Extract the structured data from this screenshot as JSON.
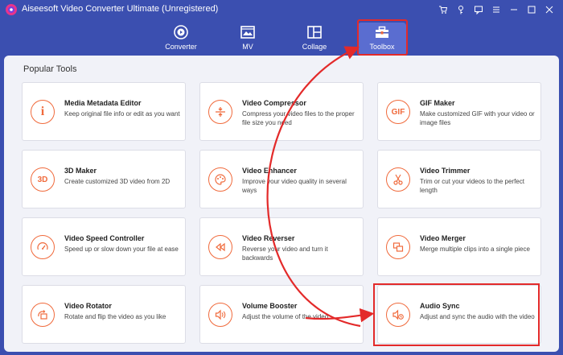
{
  "window": {
    "title": "Aiseesoft Video Converter Ultimate (Unregistered)"
  },
  "nav": {
    "tabs": [
      {
        "label": "Converter",
        "icon": "converter-icon"
      },
      {
        "label": "MV",
        "icon": "mv-icon"
      },
      {
        "label": "Collage",
        "icon": "collage-icon"
      },
      {
        "label": "Toolbox",
        "icon": "toolbox-icon",
        "active": true
      }
    ]
  },
  "section": {
    "title": "Popular Tools"
  },
  "tools": [
    {
      "name": "Media Metadata Editor",
      "desc": "Keep original file info or edit as you want",
      "icon": "info-icon",
      "glyph": "i"
    },
    {
      "name": "Video Compressor",
      "desc": "Compress your video files to the proper file size you need",
      "icon": "compress-icon"
    },
    {
      "name": "GIF Maker",
      "desc": "Make customized GIF with your video or image files",
      "icon": "gif-icon",
      "glyph": "GIF"
    },
    {
      "name": "3D Maker",
      "desc": "Create customized 3D video from 2D",
      "icon": "3d-icon",
      "glyph": "3D"
    },
    {
      "name": "Video Enhancer",
      "desc": "Improve your video quality in several ways",
      "icon": "palette-icon"
    },
    {
      "name": "Video Trimmer",
      "desc": "Trim or cut your videos to the perfect length",
      "icon": "scissors-icon"
    },
    {
      "name": "Video Speed Controller",
      "desc": "Speed up or slow down your file at ease",
      "icon": "speedometer-icon"
    },
    {
      "name": "Video Reverser",
      "desc": "Reverse your video and turn it backwards",
      "icon": "rewind-icon"
    },
    {
      "name": "Video Merger",
      "desc": "Merge multiple clips into a single piece",
      "icon": "merge-icon"
    },
    {
      "name": "Video Rotator",
      "desc": "Rotate and flip the video as you like",
      "icon": "rotate-icon"
    },
    {
      "name": "Volume Booster",
      "desc": "Adjust the volume of the video",
      "icon": "volume-icon"
    },
    {
      "name": "Audio Sync",
      "desc": "Adjust and sync the audio with the video",
      "icon": "audio-sync-icon"
    }
  ],
  "colors": {
    "accent": "#f06a3c",
    "header": "#3b4fb0",
    "annotation": "#e32a2a"
  }
}
